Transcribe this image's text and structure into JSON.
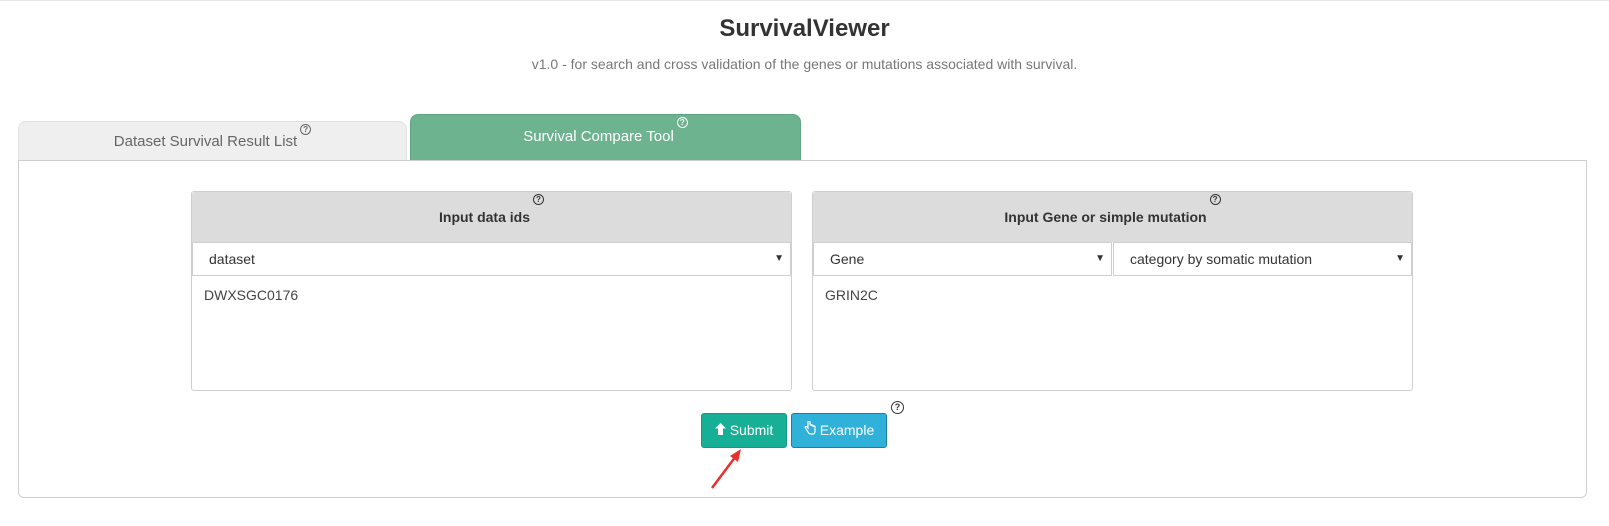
{
  "header": {
    "title": "SurvivalViewer",
    "subtitle": "v1.0 - for search and cross validation of the genes or mutations associated with survival."
  },
  "tabs": [
    {
      "label": "Dataset Survival Result List",
      "help": "?",
      "active": false
    },
    {
      "label": "Survival Compare Tool",
      "help": "?",
      "active": true
    }
  ],
  "left_box": {
    "heading": "Input data ids",
    "help": "?",
    "select_value": "dataset",
    "textarea_value": "DWXSGC0176"
  },
  "right_box": {
    "heading": "Input Gene or simple mutation",
    "help": "?",
    "type_select_value": "Gene",
    "category_select_value": "category by somatic mutation",
    "textarea_value": "GRIN2C"
  },
  "actions": {
    "submit_label": "Submit",
    "example_label": "Example",
    "help": "?"
  },
  "colors": {
    "active_tab": "#6db38f",
    "submit": "#17b097",
    "example": "#2fb1d9",
    "annotation_arrow": "#e8302c"
  },
  "icons": {
    "submit": "arrow-up-icon",
    "example": "hand-pointer-icon"
  }
}
